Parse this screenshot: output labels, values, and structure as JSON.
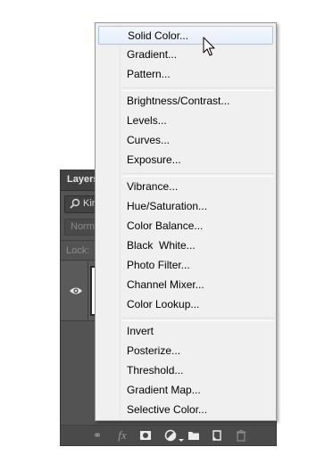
{
  "layers_panel": {
    "title": "Layers",
    "kind_label": "Kin",
    "blend_label": "Norma",
    "lock_label": "Lock:",
    "footer_icons": [
      "link-icon",
      "fx-icon",
      "mask-icon",
      "adjustment-icon",
      "folder-icon",
      "new-layer-icon",
      "trash-icon"
    ]
  },
  "menu": {
    "groups": [
      [
        "Solid Color...",
        "Gradient...",
        "Pattern..."
      ],
      [
        "Brightness/Contrast...",
        "Levels...",
        "Curves...",
        "Exposure..."
      ],
      [
        "Vibrance...",
        "Hue/Saturation...",
        "Color Balance...",
        "Black  White...",
        "Photo Filter...",
        "Channel Mixer...",
        "Color Lookup..."
      ],
      [
        "Invert",
        "Posterize...",
        "Threshold...",
        "Gradient Map...",
        "Selective Color..."
      ]
    ],
    "highlighted": "Solid Color..."
  },
  "colors": {
    "panel_bg": "#535353",
    "menu_bg": "#f0f0f0",
    "highlight_border": "#a8c6ee"
  }
}
